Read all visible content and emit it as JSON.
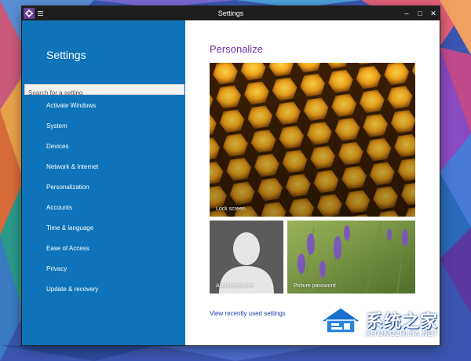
{
  "window": {
    "title": "Settings",
    "minimize_glyph": "–",
    "maximize_glyph": "□",
    "close_glyph": "✕"
  },
  "sidebar": {
    "title": "Settings",
    "search_placeholder": "Search for a setting",
    "items": [
      {
        "label": "Activate Windows"
      },
      {
        "label": "System"
      },
      {
        "label": "Devices"
      },
      {
        "label": "Network & Internet"
      },
      {
        "label": "Personalization"
      },
      {
        "label": "Accounts"
      },
      {
        "label": "Time & language"
      },
      {
        "label": "Ease of Access"
      },
      {
        "label": "Privacy"
      },
      {
        "label": "Update & recovery"
      }
    ]
  },
  "main": {
    "title": "Personalize",
    "tiles": [
      {
        "label": "Lock screen"
      },
      {
        "label": "Account picture"
      },
      {
        "label": "Picture password"
      }
    ],
    "recent_link": "View recently used settings"
  },
  "watermark": {
    "cn_text": "系统之家",
    "en_text": "XITONGZHIJIA.NET"
  },
  "colors": {
    "sidebar_bg": "#0e73b8",
    "accent_purple": "#6b2fa8",
    "titlebar_bg": "#1e1e1e"
  }
}
